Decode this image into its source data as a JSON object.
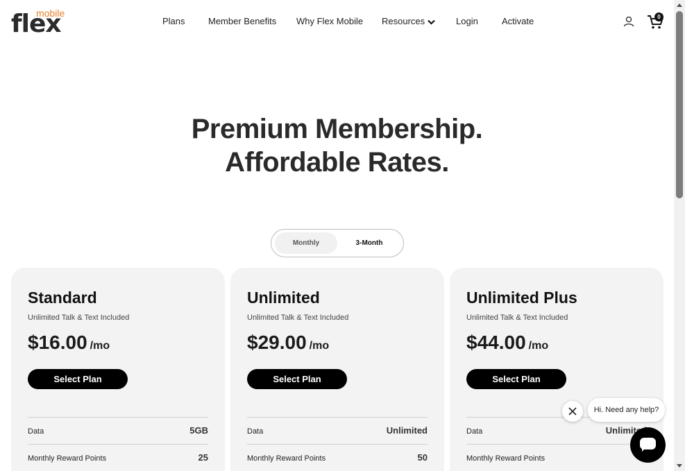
{
  "brand": {
    "name": "flex",
    "sub": "mobile",
    "accent_orange": "#e8812a"
  },
  "nav": {
    "items": [
      "Plans",
      "Member Benefits",
      "Why Flex Mobile",
      "Resources",
      "Login",
      "Activate"
    ],
    "cart_count": "0"
  },
  "hero": {
    "line1": "Premium Membership.",
    "line2": "Affordable Rates."
  },
  "billing_toggle": {
    "options": [
      "Monthly",
      "3-Month"
    ],
    "selected": "3-Month"
  },
  "plans": [
    {
      "name": "Standard",
      "subtitle": "Unlimited Talk & Text Included",
      "price": "$16.00",
      "per": "/mo",
      "button": "Select Plan",
      "features": [
        {
          "label": "Data",
          "value": "5GB"
        },
        {
          "label": "Monthly Reward Points",
          "value": "25"
        }
      ]
    },
    {
      "name": "Unlimited",
      "subtitle": "Unlimited Talk & Text Included",
      "price": "$29.00",
      "per": "/mo",
      "button": "Select Plan",
      "features": [
        {
          "label": "Data",
          "value": "Unlimited"
        },
        {
          "label": "Monthly Reward Points",
          "value": "50"
        }
      ]
    },
    {
      "name": "Unlimited Plus",
      "subtitle": "Unlimited Talk & Text Included",
      "price": "$44.00",
      "per": "/mo",
      "button": "Select Plan",
      "features": [
        {
          "label": "Data",
          "value": "Unlimited"
        },
        {
          "label": "Monthly Reward Points",
          "value": "1"
        }
      ]
    }
  ],
  "chat": {
    "prompt": "Hi. Need any help?"
  }
}
